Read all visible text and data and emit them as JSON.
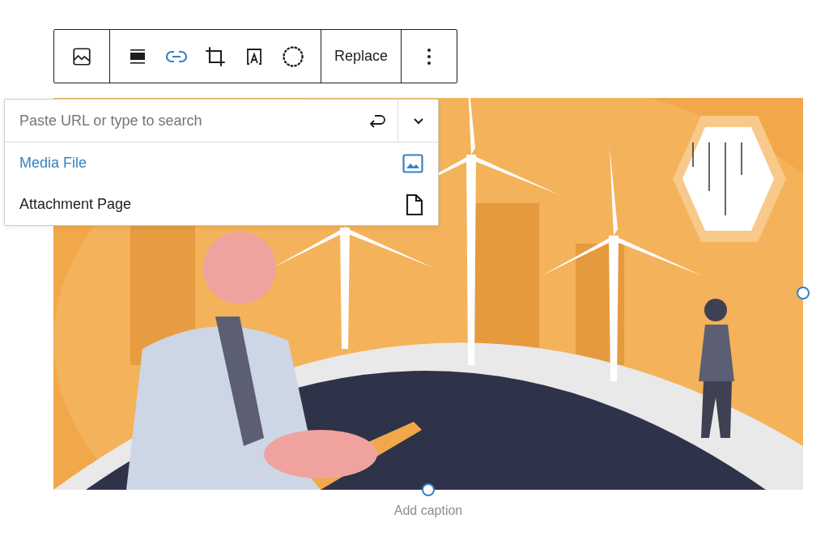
{
  "toolbar": {
    "buttons": [
      {
        "kind": "image",
        "selected": false
      },
      {
        "kind": "align",
        "selected": false
      },
      {
        "kind": "link",
        "selected": true
      },
      {
        "kind": "crop",
        "selected": false
      },
      {
        "kind": "text-overlay",
        "selected": false
      },
      {
        "kind": "duotone",
        "selected": false
      },
      {
        "kind": "label",
        "label": "Replace",
        "selected": false
      },
      {
        "kind": "more",
        "selected": false
      }
    ]
  },
  "link_popover": {
    "search": {
      "placeholder": "Paste URL or type to search"
    },
    "options": [
      {
        "label": "Media File",
        "kind": "media",
        "selected": true
      },
      {
        "label": "Attachment Page",
        "kind": "page",
        "selected": false
      }
    ]
  },
  "caption": {
    "placeholder": "Add caption"
  }
}
